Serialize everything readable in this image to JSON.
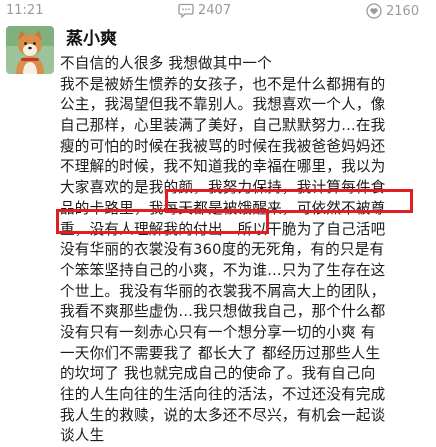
{
  "status_bar": {
    "time": "11:21",
    "comment_icon": "comment-bubble-icon",
    "comment_count": "2407",
    "like_icon": "heart-icon",
    "like_count": "2160",
    "icon_color": "#9a9a9a"
  },
  "post": {
    "avatar_icon": "shiba-dog-avatar",
    "username": "蒸小爽",
    "lines": [
      "不自信的人很多 我想做其中一个",
      "我不是被娇生惯养的女孩子，也不是什么都拥有的",
      "公主，我渴望但我不靠别人。我想喜欢一个人，像",
      "自己那样，心里装满了美好，自己默默努力…在我",
      "瘦的可怕的时候在我被骂的时候在我被爸爸妈妈还",
      "不理解的时候，我不知道我的幸福在哪里，我以为",
      "大家喜欢的是我的颜，我努力保持，我计算每件食",
      "品的卡路里，我每天都是被饿醒来，可依然不被尊",
      "重，没有人理解我的付出…所以干脆为了自己活吧",
      "没有华丽的衣裳没有360度的无死角，有的只是有",
      "个笨笨坚持自己的小爽，不为谁…只为了生存在这",
      "个世上。我没有华丽的衣裳我不屑高大上的团队，",
      "我看不爽那些虚伪…我只想做我自己，那个什么都",
      "没有只有一刻赤心只有一个想分享一切的小爽 有",
      "一天你们不需要我了 都长大了 都经历过那些人生",
      "的坎坷了 我也就完成自己的使命了。我有自己向",
      "往的人生向往的生活向往的活法，不过还没有完成",
      "我人生的救赎，说的太多还不尽兴，有机会一起谈",
      "谈人生"
    ],
    "highlight_color": "#e02020"
  }
}
